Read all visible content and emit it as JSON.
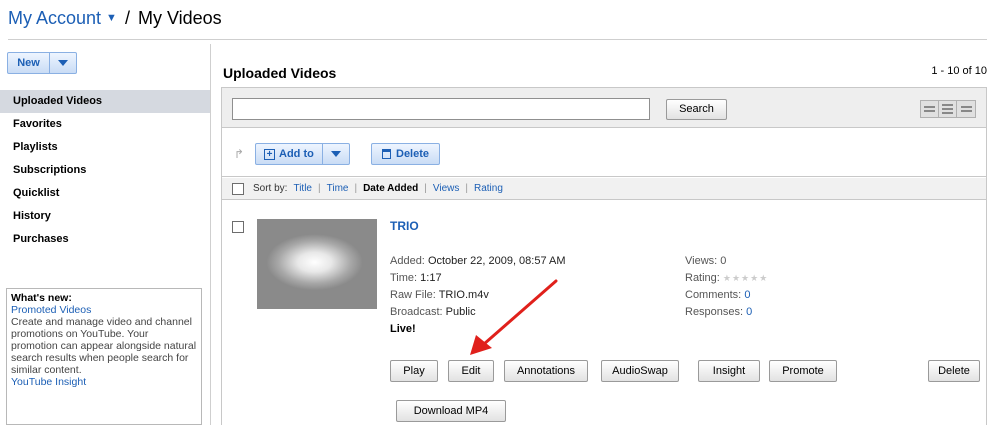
{
  "header": {
    "account_label": "My Account",
    "separator": "/",
    "title": "My Videos"
  },
  "sidebar": {
    "new_label": "New",
    "items": [
      {
        "label": "Uploaded Videos",
        "active": true
      },
      {
        "label": "Favorites"
      },
      {
        "label": "Playlists"
      },
      {
        "label": "Subscriptions"
      },
      {
        "label": "Quicklist"
      },
      {
        "label": "History"
      },
      {
        "label": "Purchases"
      }
    ],
    "whats_new": {
      "title": "What's new:",
      "link1": "Promoted Videos",
      "text1": "Create and manage video and channel promotions on YouTube. Your promotion can appear alongside natural search results when people search for similar content.",
      "link2": "YouTube Insight"
    }
  },
  "main": {
    "title": "Uploaded Videos",
    "pager": "1 - 10 of 10",
    "search": {
      "placeholder": "",
      "button": "Search"
    },
    "actions": {
      "add_to": "Add to",
      "delete": "Delete"
    },
    "sort": {
      "label": "Sort by:",
      "options": [
        "Title",
        "Time",
        "Date Added",
        "Views",
        "Rating"
      ],
      "current": "Date Added"
    },
    "video": {
      "title": "TRIO",
      "added_label": "Added:",
      "added": "October 22, 2009, 08:57 AM",
      "time_label": "Time:",
      "time": "1:17",
      "raw_label": "Raw File:",
      "raw_file": "TRIO.m4v",
      "broadcast_label": "Broadcast:",
      "broadcast": "Public",
      "status": "Live!",
      "views_label": "Views:",
      "views": "0",
      "rating_label": "Rating:",
      "rating_stars": "★★★★★",
      "comments_label": "Comments:",
      "comments": "0",
      "responses_label": "Responses:",
      "responses": "0"
    },
    "buttons": {
      "play": "Play",
      "edit": "Edit",
      "annotations": "Annotations",
      "audioswap": "AudioSwap",
      "insight": "Insight",
      "promote": "Promote",
      "delete": "Delete",
      "download": "Download MP4"
    }
  },
  "colors": {
    "link": "#1c5fb5",
    "annotation_arrow": "#e0201b",
    "active_nav": "#d5d9e0"
  }
}
